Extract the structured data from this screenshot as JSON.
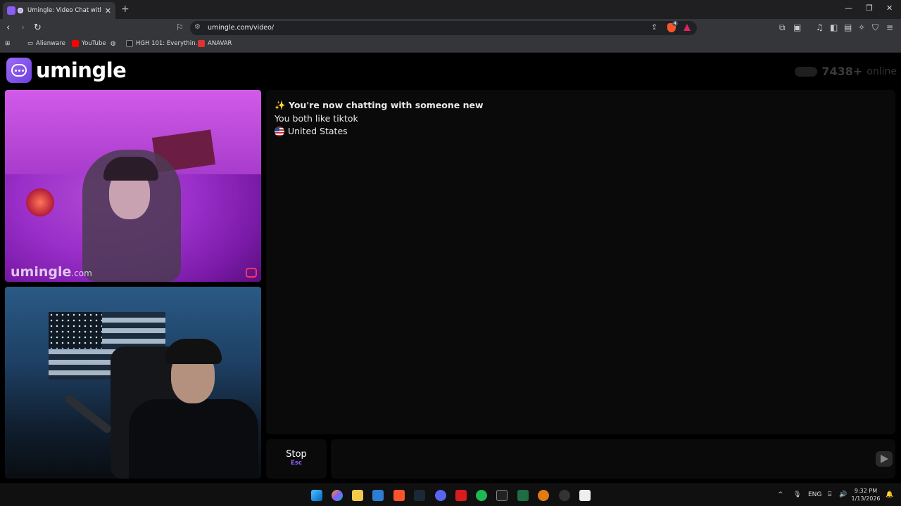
{
  "browser": {
    "tab_title": "Umingle: Video Chat with Str",
    "url": "umingle.com/video/",
    "bookmarks": [
      {
        "label": "Alienware",
        "icon": "folder-icon"
      },
      {
        "label": "YouTube",
        "icon": "youtube-icon"
      },
      {
        "label": "",
        "icon": "globe-icon"
      },
      {
        "label": "HGH 101: Everythin...",
        "icon": "site-icon"
      },
      {
        "label": "ANAVAR",
        "icon": "anavar-site-icon"
      }
    ],
    "brave_badge": "4"
  },
  "site": {
    "logo_text": "umingle",
    "online_count": "7438+",
    "online_label": "online",
    "watermark_main": "umingle",
    "watermark_suffix": ".com"
  },
  "chat": {
    "system_line": "You're now chatting with someone new",
    "interest_line": "You both like tiktok",
    "country": "United States",
    "stop_label": "Stop",
    "stop_shortcut": "Esc",
    "input_placeholder": ""
  },
  "taskbar": {
    "lang": "ENG",
    "time": "9:32 PM",
    "date": "1/13/2026"
  },
  "colors": {
    "accent": "#8b5cf6",
    "page_bg": "#000000",
    "panel_bg": "#0a0a0a"
  }
}
